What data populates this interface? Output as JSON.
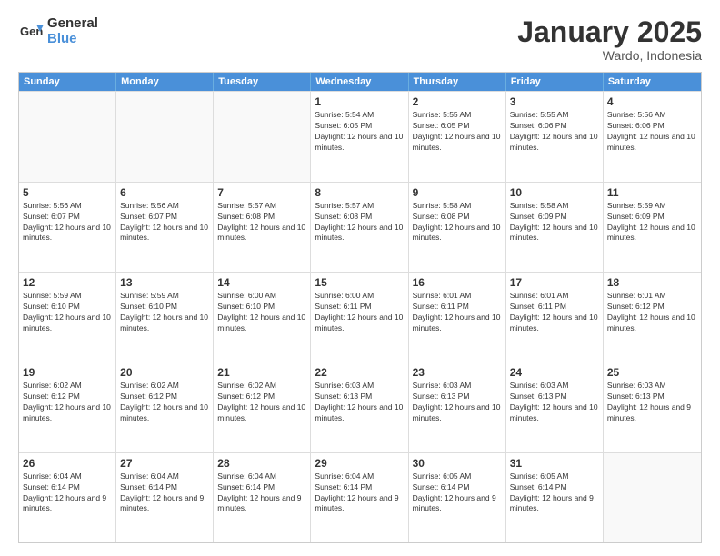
{
  "logo": {
    "general": "General",
    "blue": "Blue"
  },
  "header": {
    "month": "January 2025",
    "location": "Wardo, Indonesia"
  },
  "weekdays": [
    "Sunday",
    "Monday",
    "Tuesday",
    "Wednesday",
    "Thursday",
    "Friday",
    "Saturday"
  ],
  "rows": [
    [
      {
        "day": "",
        "info": ""
      },
      {
        "day": "",
        "info": ""
      },
      {
        "day": "",
        "info": ""
      },
      {
        "day": "1",
        "info": "Sunrise: 5:54 AM\nSunset: 6:05 PM\nDaylight: 12 hours and 10 minutes."
      },
      {
        "day": "2",
        "info": "Sunrise: 5:55 AM\nSunset: 6:05 PM\nDaylight: 12 hours and 10 minutes."
      },
      {
        "day": "3",
        "info": "Sunrise: 5:55 AM\nSunset: 6:06 PM\nDaylight: 12 hours and 10 minutes."
      },
      {
        "day": "4",
        "info": "Sunrise: 5:56 AM\nSunset: 6:06 PM\nDaylight: 12 hours and 10 minutes."
      }
    ],
    [
      {
        "day": "5",
        "info": "Sunrise: 5:56 AM\nSunset: 6:07 PM\nDaylight: 12 hours and 10 minutes."
      },
      {
        "day": "6",
        "info": "Sunrise: 5:56 AM\nSunset: 6:07 PM\nDaylight: 12 hours and 10 minutes."
      },
      {
        "day": "7",
        "info": "Sunrise: 5:57 AM\nSunset: 6:08 PM\nDaylight: 12 hours and 10 minutes."
      },
      {
        "day": "8",
        "info": "Sunrise: 5:57 AM\nSunset: 6:08 PM\nDaylight: 12 hours and 10 minutes."
      },
      {
        "day": "9",
        "info": "Sunrise: 5:58 AM\nSunset: 6:08 PM\nDaylight: 12 hours and 10 minutes."
      },
      {
        "day": "10",
        "info": "Sunrise: 5:58 AM\nSunset: 6:09 PM\nDaylight: 12 hours and 10 minutes."
      },
      {
        "day": "11",
        "info": "Sunrise: 5:59 AM\nSunset: 6:09 PM\nDaylight: 12 hours and 10 minutes."
      }
    ],
    [
      {
        "day": "12",
        "info": "Sunrise: 5:59 AM\nSunset: 6:10 PM\nDaylight: 12 hours and 10 minutes."
      },
      {
        "day": "13",
        "info": "Sunrise: 5:59 AM\nSunset: 6:10 PM\nDaylight: 12 hours and 10 minutes."
      },
      {
        "day": "14",
        "info": "Sunrise: 6:00 AM\nSunset: 6:10 PM\nDaylight: 12 hours and 10 minutes."
      },
      {
        "day": "15",
        "info": "Sunrise: 6:00 AM\nSunset: 6:11 PM\nDaylight: 12 hours and 10 minutes."
      },
      {
        "day": "16",
        "info": "Sunrise: 6:01 AM\nSunset: 6:11 PM\nDaylight: 12 hours and 10 minutes."
      },
      {
        "day": "17",
        "info": "Sunrise: 6:01 AM\nSunset: 6:11 PM\nDaylight: 12 hours and 10 minutes."
      },
      {
        "day": "18",
        "info": "Sunrise: 6:01 AM\nSunset: 6:12 PM\nDaylight: 12 hours and 10 minutes."
      }
    ],
    [
      {
        "day": "19",
        "info": "Sunrise: 6:02 AM\nSunset: 6:12 PM\nDaylight: 12 hours and 10 minutes."
      },
      {
        "day": "20",
        "info": "Sunrise: 6:02 AM\nSunset: 6:12 PM\nDaylight: 12 hours and 10 minutes."
      },
      {
        "day": "21",
        "info": "Sunrise: 6:02 AM\nSunset: 6:12 PM\nDaylight: 12 hours and 10 minutes."
      },
      {
        "day": "22",
        "info": "Sunrise: 6:03 AM\nSunset: 6:13 PM\nDaylight: 12 hours and 10 minutes."
      },
      {
        "day": "23",
        "info": "Sunrise: 6:03 AM\nSunset: 6:13 PM\nDaylight: 12 hours and 10 minutes."
      },
      {
        "day": "24",
        "info": "Sunrise: 6:03 AM\nSunset: 6:13 PM\nDaylight: 12 hours and 10 minutes."
      },
      {
        "day": "25",
        "info": "Sunrise: 6:03 AM\nSunset: 6:13 PM\nDaylight: 12 hours and 9 minutes."
      }
    ],
    [
      {
        "day": "26",
        "info": "Sunrise: 6:04 AM\nSunset: 6:14 PM\nDaylight: 12 hours and 9 minutes."
      },
      {
        "day": "27",
        "info": "Sunrise: 6:04 AM\nSunset: 6:14 PM\nDaylight: 12 hours and 9 minutes."
      },
      {
        "day": "28",
        "info": "Sunrise: 6:04 AM\nSunset: 6:14 PM\nDaylight: 12 hours and 9 minutes."
      },
      {
        "day": "29",
        "info": "Sunrise: 6:04 AM\nSunset: 6:14 PM\nDaylight: 12 hours and 9 minutes."
      },
      {
        "day": "30",
        "info": "Sunrise: 6:05 AM\nSunset: 6:14 PM\nDaylight: 12 hours and 9 minutes."
      },
      {
        "day": "31",
        "info": "Sunrise: 6:05 AM\nSunset: 6:14 PM\nDaylight: 12 hours and 9 minutes."
      },
      {
        "day": "",
        "info": ""
      }
    ]
  ]
}
